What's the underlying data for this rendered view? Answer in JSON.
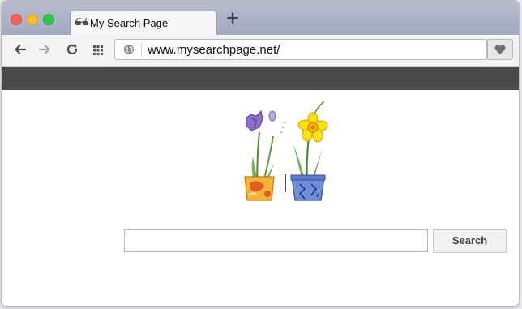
{
  "window": {
    "tab": {
      "title": "My Search Page",
      "icon": "sunglasses-icon"
    },
    "new_tab_icon": "plus-icon"
  },
  "toolbar": {
    "back_icon": "arrow-left-icon",
    "forward_icon": "arrow-right-icon",
    "reload_icon": "reload-icon",
    "apps_icon": "grid-icon",
    "site_icon": "globe-icon",
    "url": "www.mysearchpage.net/",
    "bookmark_icon": "heart-icon"
  },
  "main": {
    "logo": "flower-pots-illustration",
    "search": {
      "value": "",
      "placeholder": ""
    },
    "search_button": "Search"
  },
  "colors": {
    "close": "#fc5f57",
    "minimize": "#fdbc2e",
    "maximize": "#33c748",
    "dark_strip": "#4a4a4a"
  }
}
